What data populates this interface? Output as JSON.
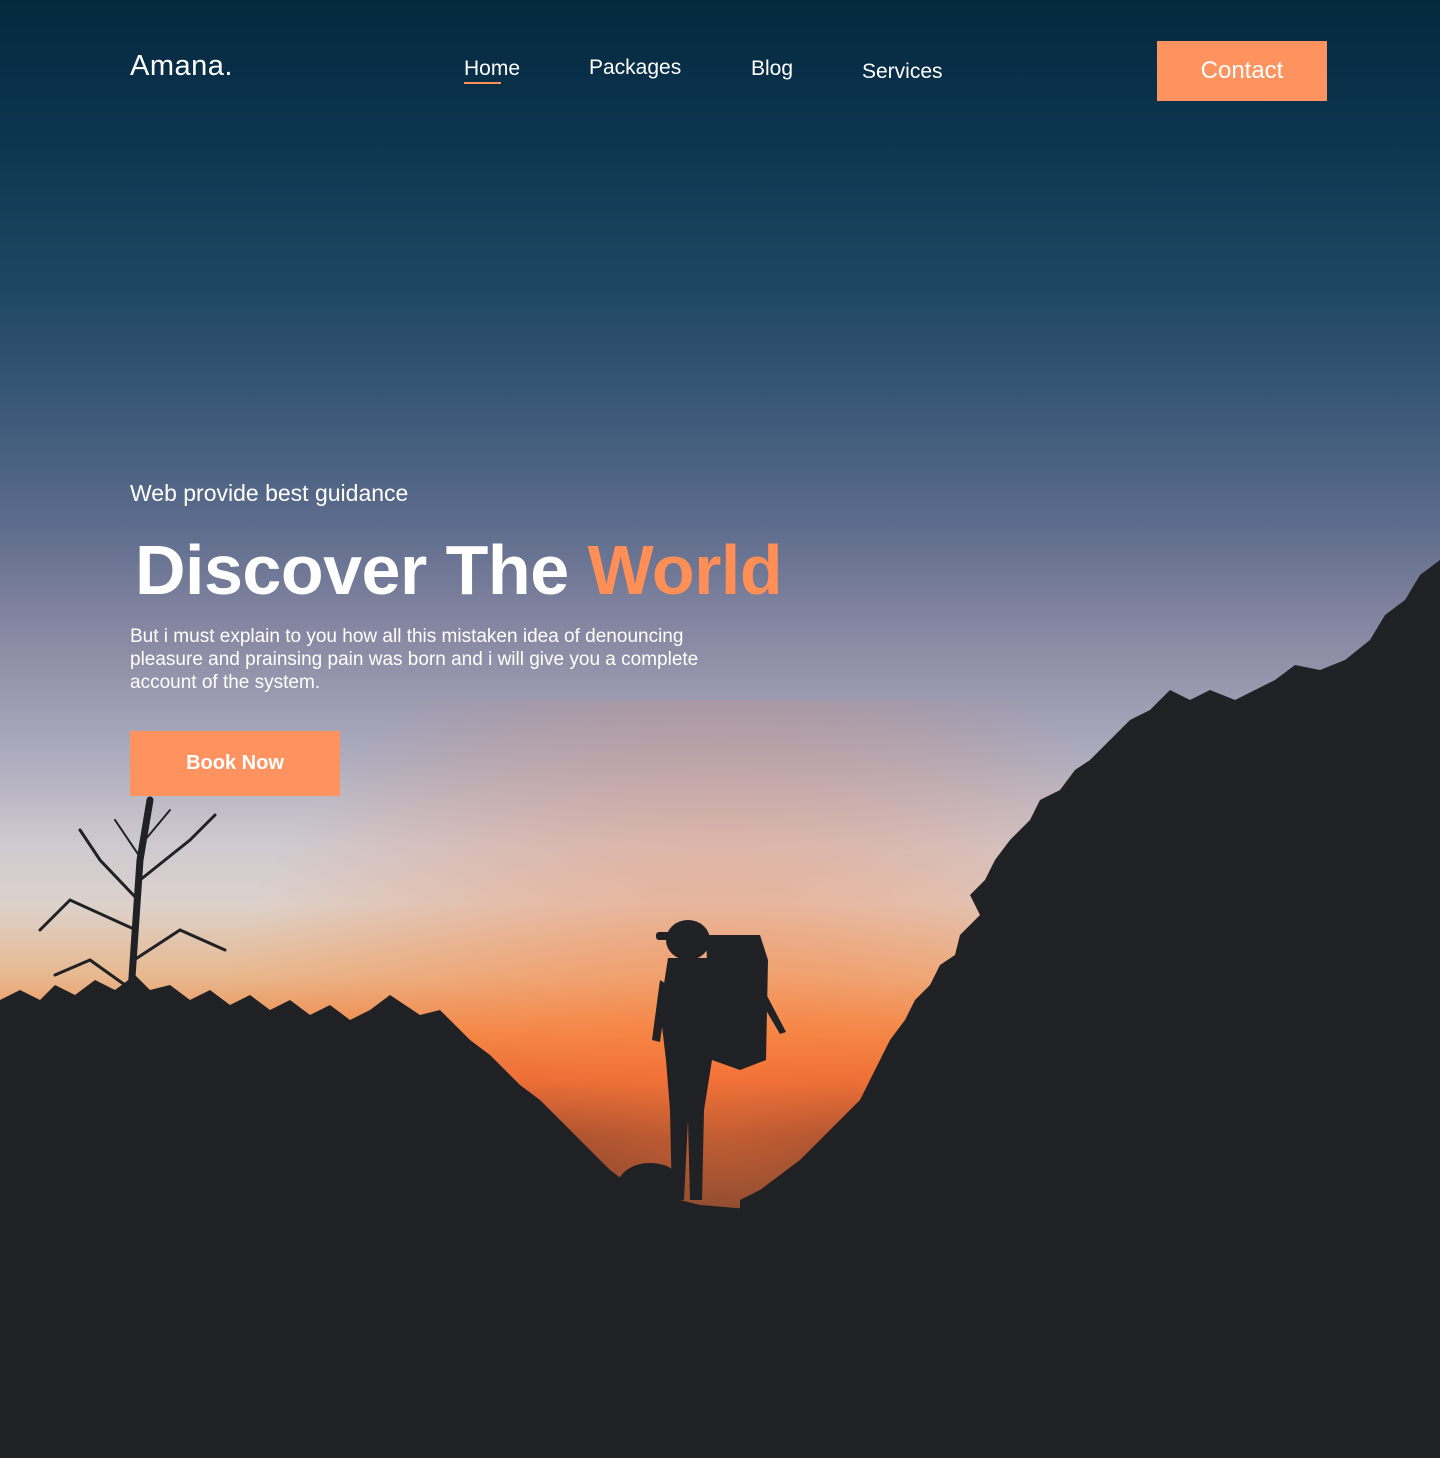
{
  "brand": {
    "name": "Amana."
  },
  "nav": {
    "items": [
      {
        "label": "Home",
        "active": true
      },
      {
        "label": "Packages",
        "active": false
      },
      {
        "label": "Blog",
        "active": false
      },
      {
        "label": "Services",
        "active": false
      }
    ],
    "contact_label": "Contact"
  },
  "hero": {
    "tagline": "Web provide best guidance",
    "headline_main": "Discover The",
    "headline_accent": "World",
    "description": "But i must explain to you how all this mistaken idea of denouncing pleasure and prainsing pain was born and i will give you a complete account of the system.",
    "cta_label": "Book Now"
  },
  "colors": {
    "accent": "#ff9360",
    "text": "#ffffff",
    "ground": "#1f2125",
    "sky_top": "#03293f"
  }
}
